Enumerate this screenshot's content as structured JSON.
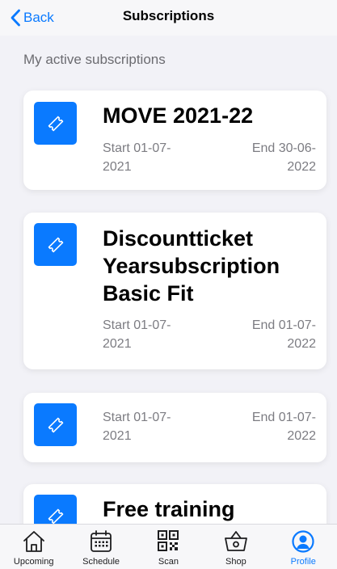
{
  "nav": {
    "back_label": "Back",
    "title": "Subscriptions"
  },
  "section_title": "My active subscriptions",
  "subscriptions": [
    {
      "title": "MOVE 2021-22",
      "start_label": "Start 01-07-2021",
      "start_line1": "Start 01-07-",
      "start_line2": "2021",
      "end_line1": "End 30-06-",
      "end_line2": "2022"
    },
    {
      "title": "Discountticket Yearsubscription Basic Fit",
      "title_line1": "Discountticket",
      "title_line2": "Yearsubscription",
      "title_line3": "Basic Fit",
      "start_line1": "Start 01-07-",
      "start_line2": "2021",
      "end_line1": "End 01-07-",
      "end_line2": "2022"
    },
    {
      "title": "",
      "start_line1": "Start 01-07-",
      "start_line2": "2021",
      "end_line1": "End 01-07-",
      "end_line2": "2022"
    },
    {
      "title": "Free training"
    }
  ],
  "tabs": [
    {
      "label": "Upcoming",
      "icon": "home-icon"
    },
    {
      "label": "Schedule",
      "icon": "calendar-icon"
    },
    {
      "label": "Scan",
      "icon": "qr-code-icon"
    },
    {
      "label": "Shop",
      "icon": "shopping-basket-icon"
    },
    {
      "label": "Profile",
      "icon": "profile-icon",
      "active": true
    }
  ],
  "colors": {
    "accent": "#0a7aff",
    "background": "#f2f2f7",
    "secondary_text": "#7c7c82"
  }
}
